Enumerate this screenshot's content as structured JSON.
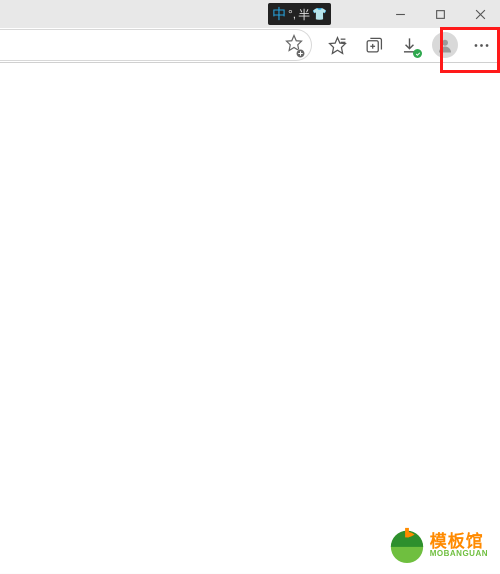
{
  "ime": {
    "mode_cn": "中",
    "punct": "°,",
    "width": "半",
    "extra": "👕"
  },
  "window_controls": {
    "minimize": "minimize-icon",
    "maximize": "maximize-icon",
    "close": "close-icon"
  },
  "toolbar": {
    "add_favorite": "favorite-add-icon",
    "favorites": "favorites-icon",
    "collections": "collections-icon",
    "downloads": "downloads-icon",
    "downloads_status": "complete",
    "profile": "profile-icon",
    "menu": "more-icon"
  },
  "highlight": {
    "target": "settings-menu-button"
  },
  "watermark": {
    "name_cn": "模板馆",
    "name_en": "MOBANGUAN"
  }
}
